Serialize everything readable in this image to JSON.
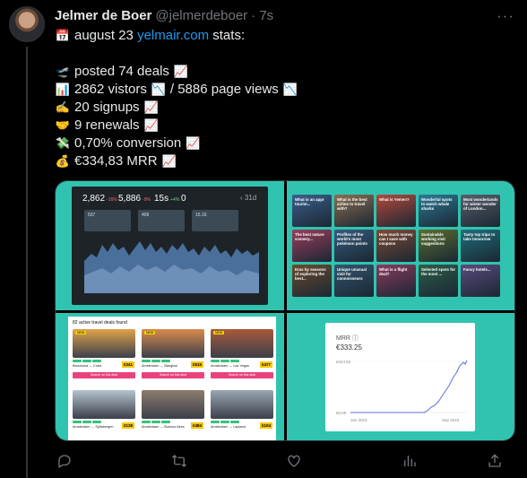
{
  "tweet": {
    "author_name": "Jelmer de Boer",
    "handle": "@jelmerdeboer",
    "time": "· 7s",
    "more": "···",
    "line1": {
      "emoji": "📅",
      "pre": "august 23 ",
      "link": "yelmair.com",
      "post": " stats:"
    },
    "stats": [
      {
        "emoji": "🛫",
        "text": "posted 74 deals",
        "trend": "📈"
      },
      {
        "emoji": "📊",
        "text": "2862 vistors",
        "trend": "📉",
        "text2": " / 5886 page views",
        "trend2": "📉"
      },
      {
        "emoji": "✍️",
        "text": "20 signups",
        "trend": "📈"
      },
      {
        "emoji": "🤝",
        "text": "9 renewals",
        "trend": "📈"
      },
      {
        "emoji": "💸",
        "text": "0,70% conversion",
        "trend": "📈"
      },
      {
        "emoji": "💰",
        "text": "€334,83 MRR",
        "trend": "📈"
      }
    ]
  },
  "dashboard": {
    "visitors": "2,862",
    "visitors_delta": "-16%",
    "pageviews": "5,886",
    "pageviews_delta": "-9%",
    "duration": "15s",
    "duration_delta": "+4%",
    "realtime": "0",
    "range": "31d",
    "panels": [
      "537",
      "409",
      "15.16"
    ]
  },
  "grid_cards": [
    {
      "title": "What is an appr tourist...",
      "color": "#3b5f8c"
    },
    {
      "title": "What is the best airline to travel with?",
      "color": "#8b6d52"
    },
    {
      "title": "What is Yemen?",
      "color": "#b5483c"
    },
    {
      "title": "Wonderful spots to watch whale sharks",
      "color": "#2c7a96"
    },
    {
      "title": "Most wonderlands for winter wonder of London...",
      "color": "#57606b"
    },
    {
      "title": "The best nature scenery...",
      "color": "#9b3d5d"
    },
    {
      "title": "Profiles of the world's most pokémon points",
      "color": "#355c7d"
    },
    {
      "title": "How much money can I save with coupons",
      "color": "#7d4b36"
    },
    {
      "title": "Sustainable working visit suggestions",
      "color": "#5a6f2f"
    },
    {
      "title": "Tasty top trips to take tomorrow",
      "color": "#1e6f7a"
    },
    {
      "title": "Eras by seasons of exploring the best...",
      "color": "#6a4b2e"
    },
    {
      "title": "Unique unusual visit for connoisseurs",
      "color": "#33556e"
    },
    {
      "title": "What is a flight deal?",
      "color": "#8a3a5e"
    },
    {
      "title": "Selected spots for the most ...",
      "color": "#2d5d48"
    },
    {
      "title": "Fancy hotels...",
      "color": "#5b4a7d"
    }
  ],
  "deals_page": {
    "title": "82 active travel deals found",
    "badge": "NEW",
    "deals": [
      {
        "route": "Barcelona → Cuba",
        "price": "€341",
        "button": "Search on this deal",
        "color": "#e0a24a",
        "new": true
      },
      {
        "route": "Amsterdam → Bangkok",
        "price": "€515",
        "button": "Search on this deal",
        "color": "#d98a4d",
        "new": true
      },
      {
        "route": "Amsterdam → Las Vegas",
        "price": "€477",
        "button": "Search on this deal",
        "color": "#a85a3a",
        "new": true
      },
      {
        "route": "Amsterdam → Spitsbergen",
        "price": "€138",
        "button": "",
        "color": "#b4c4cf",
        "new": false
      },
      {
        "route": "Amsterdam → Buenos Aires",
        "price": "€484",
        "button": "",
        "color": "#8d7b6f",
        "new": false
      },
      {
        "route": "Amsterdam → Lapland",
        "price": "€104",
        "button": "",
        "color": "#9aa6b3",
        "new": false
      }
    ]
  },
  "mrr_card": {
    "label": "MRR ⓘ",
    "value": "€333.25",
    "y_top": "€324.82",
    "y_bottom": "€0.00",
    "x_start": "Jan 2023",
    "x_end": "Sep 2023"
  },
  "actions": {
    "reply": "reply-icon",
    "retweet": "retweet-icon",
    "like": "like-icon",
    "views": "views-icon",
    "share": "share-icon"
  }
}
